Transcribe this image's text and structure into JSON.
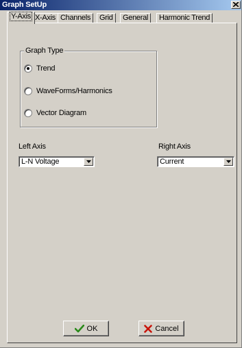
{
  "window": {
    "title": "Graph SetUp"
  },
  "tabs": [
    {
      "label": "Y-Axis",
      "active": true
    },
    {
      "label": "X-Axis"
    },
    {
      "label": "Channels"
    },
    {
      "label": "Grid"
    },
    {
      "label": "General"
    },
    {
      "label": "Harmonic Trend"
    }
  ],
  "graph_type": {
    "label": "Graph Type",
    "options": [
      {
        "label": "Trend",
        "selected": true
      },
      {
        "label": "WaveForms/Harmonics",
        "selected": false
      },
      {
        "label": "Vector Diagram",
        "selected": false
      }
    ]
  },
  "left_axis": {
    "label": "Left Axis",
    "value": "L-N Voltage"
  },
  "right_axis": {
    "label": "Right Axis",
    "value": "Current"
  },
  "buttons": {
    "ok": "OK",
    "cancel": "Cancel"
  },
  "icons": {
    "ok": "check-icon",
    "cancel": "x-icon",
    "close": "close-icon",
    "dropdown": "chevron-down-icon"
  },
  "colors": {
    "titlebar_start": "#0a246a",
    "titlebar_end": "#a6caf0",
    "face": "#d4d0c8",
    "ok_icon": "#2a8a1a",
    "cancel_icon": "#c8140a"
  }
}
